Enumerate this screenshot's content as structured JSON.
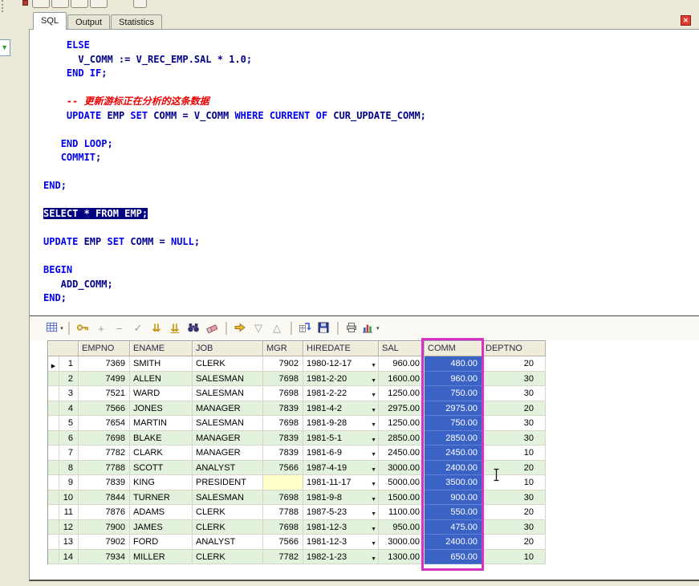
{
  "window": {
    "close_glyph": "✕",
    "left_dropdown_glyph": "▼"
  },
  "tabs": {
    "items": [
      {
        "label": "SQL",
        "active": true
      },
      {
        "label": "Output",
        "active": false
      },
      {
        "label": "Statistics",
        "active": false
      }
    ]
  },
  "editor": {
    "lines": [
      [
        [
          "d",
          "    "
        ],
        [
          "k",
          "ELSE"
        ]
      ],
      [
        [
          "d",
          "      V_COMM := V_REC_EMP.SAL * 1.0;"
        ]
      ],
      [
        [
          "d",
          "    "
        ],
        [
          "k",
          "END IF"
        ],
        [
          "d",
          ";"
        ]
      ],
      [],
      [
        [
          "c",
          "    -- 更新游标正在分析的这条数据"
        ]
      ],
      [
        [
          "d",
          "    "
        ],
        [
          "k",
          "UPDATE"
        ],
        [
          "d",
          " EMP "
        ],
        [
          "k",
          "SET"
        ],
        [
          "d",
          " COMM = V_COMM "
        ],
        [
          "k",
          "WHERE"
        ],
        [
          "d",
          " "
        ],
        [
          "k",
          "CURRENT"
        ],
        [
          "d",
          " "
        ],
        [
          "k",
          "OF"
        ],
        [
          "d",
          " CUR_UPDATE_COMM;"
        ]
      ],
      [],
      [
        [
          "d",
          "   "
        ],
        [
          "k",
          "END LOOP"
        ],
        [
          "d",
          ";"
        ]
      ],
      [
        [
          "d",
          "   "
        ],
        [
          "k",
          "COMMIT"
        ],
        [
          "d",
          ";"
        ]
      ],
      [],
      [
        [
          "k",
          "END"
        ],
        [
          "d",
          ";"
        ]
      ],
      [],
      [
        [
          "sel",
          "SELECT * FROM EMP;"
        ]
      ],
      [],
      [
        [
          "k",
          "UPDATE"
        ],
        [
          "d",
          " EMP "
        ],
        [
          "k",
          "SET"
        ],
        [
          "d",
          " COMM = "
        ],
        [
          "k",
          "NULL"
        ],
        [
          "d",
          ";"
        ]
      ],
      [],
      [
        [
          "k",
          "BEGIN"
        ]
      ],
      [
        [
          "d",
          "   ADD_COMM;"
        ]
      ],
      [
        [
          "k",
          "END"
        ],
        [
          "d",
          ";"
        ]
      ]
    ]
  },
  "toolbar": {
    "dropdown_glyph": "▾",
    "items": [
      {
        "name": "grid-mode-icon",
        "split": true
      },
      {
        "name": "separator"
      },
      {
        "name": "key-icon"
      },
      {
        "name": "insert-record-icon",
        "glyph": "+",
        "cls": "g-dis"
      },
      {
        "name": "delete-record-icon",
        "glyph": "−",
        "cls": "g-dis"
      },
      {
        "name": "post-record-icon",
        "glyph": "✓",
        "cls": "g-dis"
      },
      {
        "name": "fetch-next-page-icon",
        "glyph": "⇊",
        "cls": "g-gold"
      },
      {
        "name": "fetch-last-page-icon",
        "glyph": "⇊",
        "cls": "g-gold g-ul"
      },
      {
        "name": "find-icon"
      },
      {
        "name": "eraser-icon"
      },
      {
        "name": "separator"
      },
      {
        "name": "export-icon"
      },
      {
        "name": "sort-desc-icon",
        "glyph": "▽",
        "cls": "g-dis"
      },
      {
        "name": "sort-asc-icon",
        "glyph": "△",
        "cls": "g-dis"
      },
      {
        "name": "separator"
      },
      {
        "name": "link-grid-icon"
      },
      {
        "name": "save-icon"
      },
      {
        "name": "separator"
      },
      {
        "name": "print-icon"
      },
      {
        "name": "chart-icon",
        "split": true
      }
    ]
  },
  "grid": {
    "columns": [
      "EMPNO",
      "ENAME",
      "JOB",
      "MGR",
      "HIREDATE",
      "SAL",
      "COMM",
      "DEPTNO"
    ],
    "highlighted_column": "COMM",
    "current_row_glyph": "▶",
    "date_dropdown_glyph": "▼",
    "rows": [
      {
        "num": "1",
        "current": true,
        "cells": [
          "7369",
          "SMITH",
          "CLERK",
          "7902",
          "1980-12-17",
          "960.00",
          "480.00",
          "20"
        ]
      },
      {
        "num": "2",
        "cells": [
          "7499",
          "ALLEN",
          "SALESMAN",
          "7698",
          "1981-2-20",
          "1600.00",
          "960.00",
          "30"
        ]
      },
      {
        "num": "3",
        "cells": [
          "7521",
          "WARD",
          "SALESMAN",
          "7698",
          "1981-2-22",
          "1250.00",
          "750.00",
          "30"
        ]
      },
      {
        "num": "4",
        "cells": [
          "7566",
          "JONES",
          "MANAGER",
          "7839",
          "1981-4-2",
          "2975.00",
          "2975.00",
          "20"
        ]
      },
      {
        "num": "5",
        "cells": [
          "7654",
          "MARTIN",
          "SALESMAN",
          "7698",
          "1981-9-28",
          "1250.00",
          "750.00",
          "30"
        ]
      },
      {
        "num": "6",
        "cells": [
          "7698",
          "BLAKE",
          "MANAGER",
          "7839",
          "1981-5-1",
          "2850.00",
          "2850.00",
          "30"
        ]
      },
      {
        "num": "7",
        "cells": [
          "7782",
          "CLARK",
          "MANAGER",
          "7839",
          "1981-6-9",
          "2450.00",
          "2450.00",
          "10"
        ]
      },
      {
        "num": "8",
        "cells": [
          "7788",
          "SCOTT",
          "ANALYST",
          "7566",
          "1987-4-19",
          "3000.00",
          "2400.00",
          "20"
        ]
      },
      {
        "num": "9",
        "cells": [
          "7839",
          "KING",
          "PRESIDENT",
          "",
          "1981-11-17",
          "5000.00",
          "3500.00",
          "10"
        ]
      },
      {
        "num": "10",
        "cells": [
          "7844",
          "TURNER",
          "SALESMAN",
          "7698",
          "1981-9-8",
          "1500.00",
          "900.00",
          "30"
        ]
      },
      {
        "num": "11",
        "cells": [
          "7876",
          "ADAMS",
          "CLERK",
          "7788",
          "1987-5-23",
          "1100.00",
          "550.00",
          "20"
        ]
      },
      {
        "num": "12",
        "cells": [
          "7900",
          "JAMES",
          "CLERK",
          "7698",
          "1981-12-3",
          "950.00",
          "475.00",
          "30"
        ]
      },
      {
        "num": "13",
        "cells": [
          "7902",
          "FORD",
          "ANALYST",
          "7566",
          "1981-12-3",
          "3000.00",
          "2400.00",
          "20"
        ]
      },
      {
        "num": "14",
        "cells": [
          "7934",
          "MILLER",
          "CLERK",
          "7782",
          "1982-1-23",
          "1300.00",
          "650.00",
          "10"
        ]
      }
    ]
  },
  "colors": {
    "comm_selection_bg": "#3b63c6",
    "highlight_border": "#d932c8",
    "row_stripe": "#e3f2dd",
    "null_cell_bg": "#ffffc8",
    "selection_bg": "#000080"
  }
}
